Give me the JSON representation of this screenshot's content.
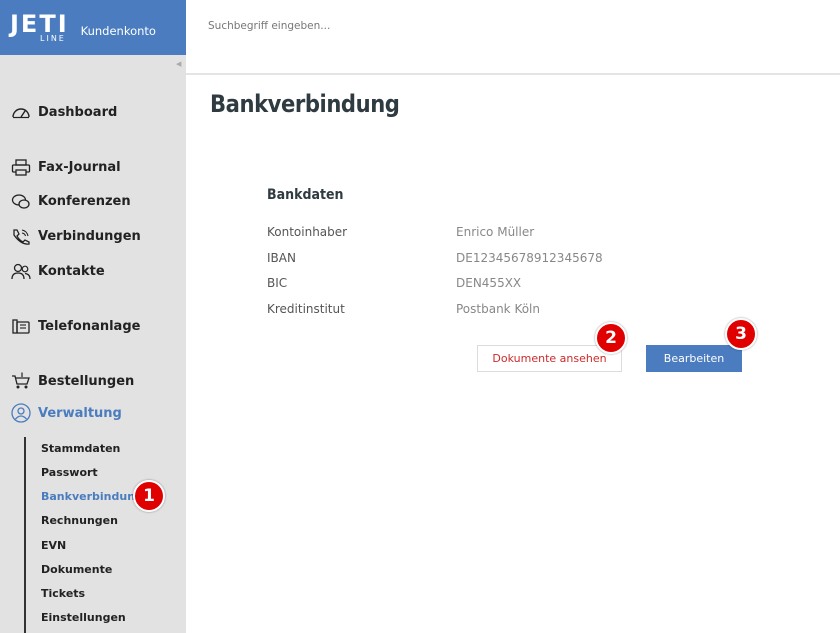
{
  "brand": {
    "logo_top": "JETI",
    "logo_bottom": "LINE",
    "subtitle": "Kundenkonto"
  },
  "search": {
    "placeholder": "Suchbegriff eingeben..."
  },
  "nav": {
    "dashboard": "Dashboard",
    "fax": "Fax-Journal",
    "konferenzen": "Konferenzen",
    "verbindungen": "Verbindungen",
    "kontakte": "Kontakte",
    "telefonanlage": "Telefonanlage",
    "bestellungen": "Bestellungen",
    "verwaltung": "Verwaltung"
  },
  "subnav": [
    "Stammdaten",
    "Passwort",
    "Bankverbindung",
    "Rechnungen",
    "EVN",
    "Dokumente",
    "Tickets",
    "Einstellungen"
  ],
  "page": {
    "title": "Bankverbindung"
  },
  "bank": {
    "title": "Bankdaten",
    "rows": [
      {
        "label": "Kontoinhaber",
        "value": "Enrico Müller"
      },
      {
        "label": "IBAN",
        "value": "DE12345678912345678"
      },
      {
        "label": "BIC",
        "value": "DEN455XX"
      },
      {
        "label": "Kreditinstitut",
        "value": "Postbank Köln"
      }
    ]
  },
  "buttons": {
    "docs": "Dokumente ansehen",
    "edit": "Bearbeiten"
  },
  "markers": [
    "1",
    "2",
    "3"
  ],
  "colors": {
    "accent": "#4a7cbf",
    "sidebar": "#e2e2e2",
    "danger": "#cc2b2b",
    "marker": "#e00000"
  }
}
